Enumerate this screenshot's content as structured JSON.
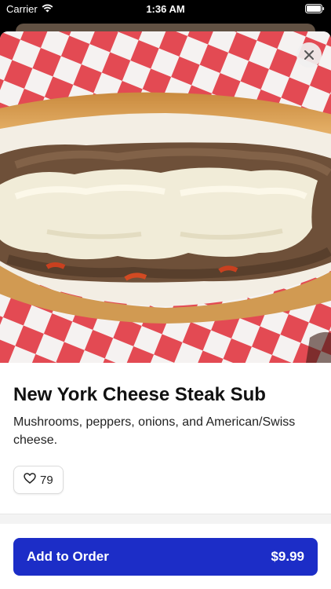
{
  "status_bar": {
    "carrier": "Carrier",
    "time": "1:36 AM"
  },
  "item": {
    "name": "New York Cheese Steak Sub",
    "description": "Mushrooms, peppers, onions, and American/Swiss cheese.",
    "likes": "79",
    "image_icon": "cheese-steak-photo"
  },
  "order_button": {
    "label": "Add to Order",
    "price": "$9.99"
  },
  "colors": {
    "accent": "#1c2dc7",
    "checker_red": "#e0323c",
    "background": "#ffffff"
  }
}
